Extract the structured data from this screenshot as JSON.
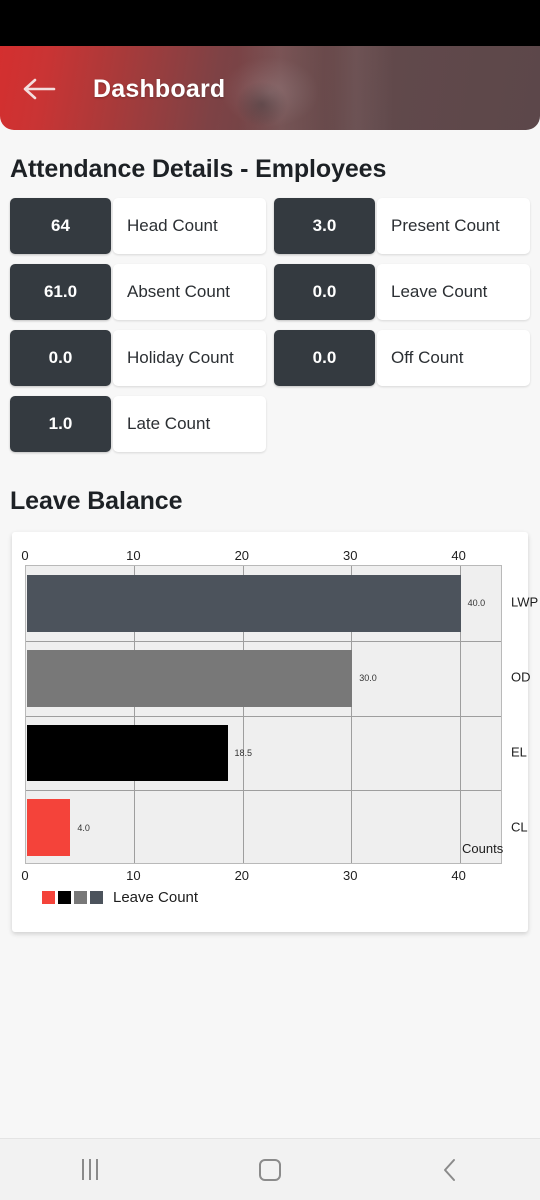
{
  "statusbar": {
    "background": "#000000"
  },
  "header": {
    "title": "Dashboard",
    "back_icon": "arrow-left-icon",
    "gradient_from": "#d42f2f",
    "gradient_to": "#5c474a"
  },
  "attendance": {
    "section_title": "Attendance Details - Employees",
    "card_bg": "#343a40",
    "cards": [
      {
        "value": "64",
        "label": "Head Count"
      },
      {
        "value": "3.0",
        "label": "Present Count"
      },
      {
        "value": "61.0",
        "label": "Absent Count"
      },
      {
        "value": "0.0",
        "label": "Leave Count"
      },
      {
        "value": "0.0",
        "label": "Holiday Count"
      },
      {
        "value": "0.0",
        "label": "Off Count"
      },
      {
        "value": "1.0",
        "label": "Late Count"
      }
    ]
  },
  "leave_balance": {
    "section_title": "Leave Balance"
  },
  "chart_data": {
    "type": "bar",
    "orientation": "horizontal",
    "title": "Leave Balance",
    "categories": [
      "LWP",
      "OD",
      "EL",
      "CL"
    ],
    "values": [
      40.0,
      30.0,
      18.5,
      4.0
    ],
    "data_labels": [
      "40.0",
      "30.0",
      "18.5",
      "4.0"
    ],
    "colors": [
      "#4c535c",
      "#787878",
      "#000000",
      "#f4433a"
    ],
    "xlabel": "Counts",
    "ylabel": "",
    "xlim": [
      0,
      44
    ],
    "xticks": [
      0,
      10,
      20,
      30,
      40
    ],
    "xtick_labels": [
      "0",
      "10",
      "20",
      "30",
      "40"
    ],
    "xaxis_top_labels": [
      "0",
      "10",
      "20",
      "30",
      "40"
    ],
    "grid": true,
    "legend": {
      "position": "bottom-left",
      "entries": [
        {
          "label": "Leave Count",
          "swatches": [
            "#f4433a",
            "#000000",
            "#787878",
            "#4c535c"
          ]
        }
      ]
    },
    "plot_background": "#efefef"
  },
  "navbar": {
    "recents_icon": "recents-icon",
    "home_icon": "home-icon",
    "back_icon": "chevron-left-icon"
  }
}
